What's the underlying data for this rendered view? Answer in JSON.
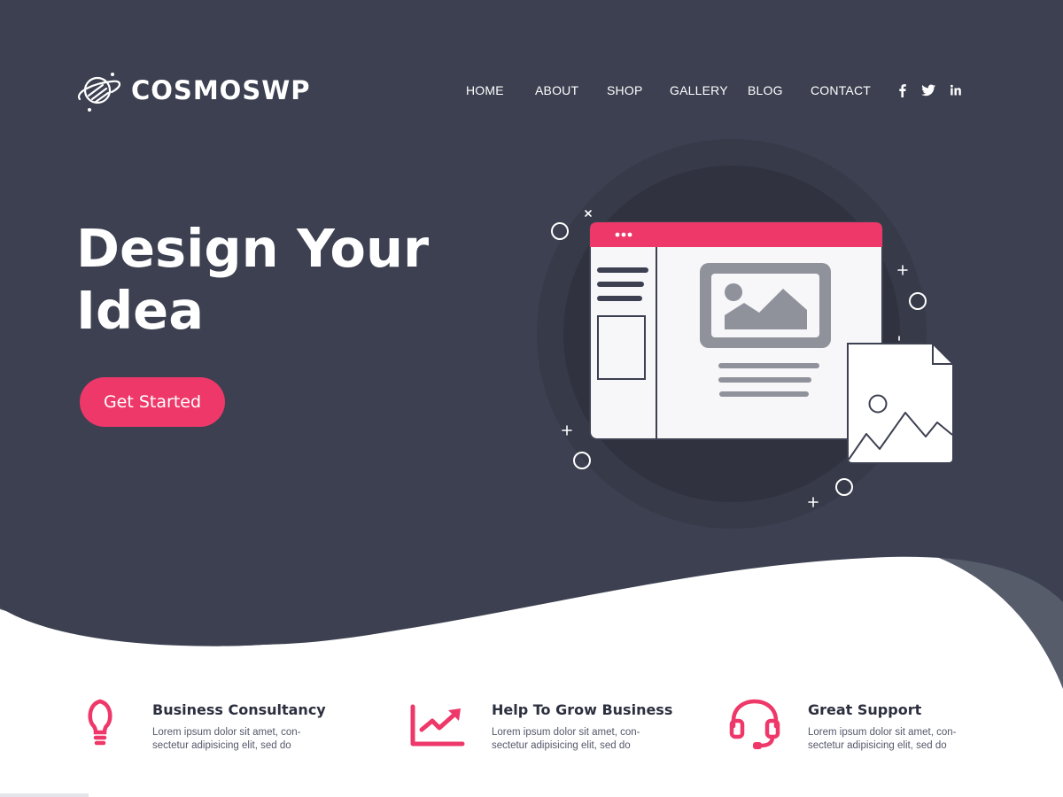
{
  "brand": {
    "name": "COSMOSWP",
    "logo_icon": "planet-icon"
  },
  "nav": {
    "items": [
      {
        "label": "HOME"
      },
      {
        "label": "ABOUT"
      },
      {
        "label": "SHOP"
      },
      {
        "label": "GALLERY"
      },
      {
        "label": "BLOG"
      },
      {
        "label": "CONTACT"
      }
    ],
    "social": [
      {
        "icon": "facebook-icon"
      },
      {
        "icon": "twitter-icon"
      },
      {
        "icon": "linkedin-icon"
      }
    ]
  },
  "hero": {
    "title_line1": "Design Your",
    "title_line2": "Idea",
    "cta_label": "Get Started"
  },
  "features": [
    {
      "icon": "lightbulb-icon",
      "title": "Business Consultancy",
      "desc_line1": "Lorem ipsum dolor sit amet, con-",
      "desc_line2": "sectetur adipisicing elit, sed do"
    },
    {
      "icon": "growth-chart-icon",
      "title": "Help To Grow Business",
      "desc_line1": "Lorem ipsum dolor sit amet, con-",
      "desc_line2": "sectetur adipisicing elit, sed do"
    },
    {
      "icon": "headset-icon",
      "title": "Great Support",
      "desc_line1": "Lorem ipsum dolor sit amet, con-",
      "desc_line2": "sectetur adipisicing elit, sed do"
    }
  ],
  "colors": {
    "hero_background": "#3c4050",
    "wave_accent": "#575c6b",
    "accent": "#ee3869",
    "white": "#ffffff"
  }
}
